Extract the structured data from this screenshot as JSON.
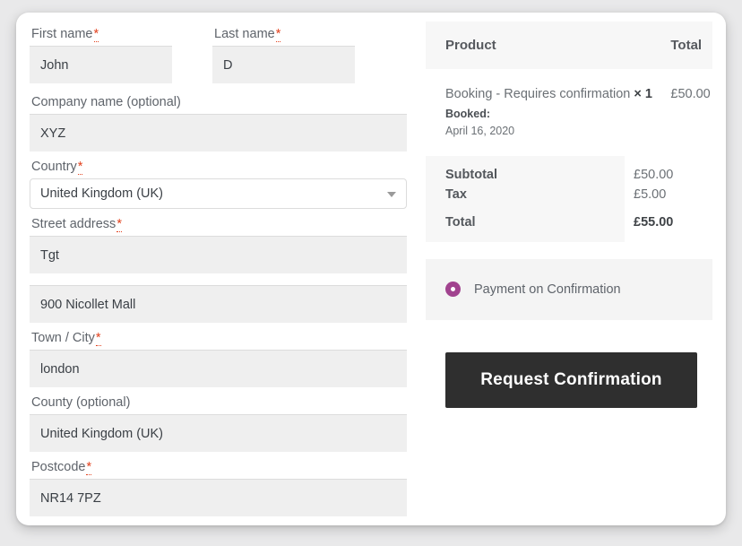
{
  "billing": {
    "fields": [
      {
        "label": "First name",
        "required": true,
        "value": "John",
        "type": "text",
        "name": "first-name"
      },
      {
        "label": "Last name",
        "required": true,
        "value": "D",
        "type": "text",
        "name": "last-name"
      },
      {
        "label": "Company name (optional)",
        "required": false,
        "value": "XYZ",
        "type": "text",
        "name": "company-name"
      },
      {
        "label": "Country",
        "required": true,
        "value": "United Kingdom (UK)",
        "type": "select",
        "name": "country"
      },
      {
        "label": "Street address",
        "required": true,
        "value": "Tgt",
        "type": "text",
        "name": "street-address-1"
      },
      {
        "label": "",
        "required": false,
        "value": "900 Nicollet Mall",
        "type": "text",
        "name": "street-address-2"
      },
      {
        "label": "Town / City",
        "required": true,
        "value": "london",
        "type": "text",
        "name": "town-city"
      },
      {
        "label": "County (optional)",
        "required": false,
        "value": "United Kingdom (UK)",
        "type": "text",
        "name": "county"
      },
      {
        "label": "Postcode",
        "required": true,
        "value": "NR14 7PZ",
        "type": "text",
        "name": "postcode"
      }
    ],
    "required_marker": "*"
  },
  "order": {
    "headers": {
      "product": "Product",
      "total": "Total"
    },
    "items": [
      {
        "name": "Booking - Requires confirmation",
        "quantity_label": "× 1",
        "amount": "£50.00",
        "meta_label": "Booked:",
        "meta_value": "April 16, 2020"
      }
    ],
    "totals": [
      {
        "label": "Subtotal",
        "value": "£50.00",
        "bold": false
      },
      {
        "label": "Tax",
        "value": "£5.00",
        "bold": false
      },
      {
        "label": "Total",
        "value": "£55.00",
        "bold": true
      }
    ]
  },
  "payment": {
    "selected_method": "Payment on Confirmation",
    "radio_color": "#a1438f"
  },
  "submit": {
    "label": "Request Confirmation",
    "background": "#2f2f2f"
  }
}
